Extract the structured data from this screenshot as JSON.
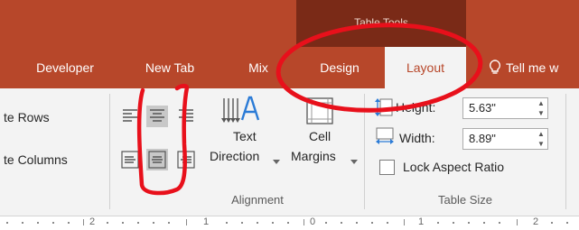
{
  "context": {
    "label": "Table Tools"
  },
  "tabs": [
    {
      "label": "Developer"
    },
    {
      "label": "New Tab"
    },
    {
      "label": "Mix"
    },
    {
      "label": "Design"
    },
    {
      "label": "Layout"
    },
    {
      "label": "Tell me w",
      "icon": "lightbulb-icon"
    }
  ],
  "rows_columns": {
    "rows_label": "te Rows",
    "columns_label": "te Columns"
  },
  "alignment": {
    "text_direction": {
      "line1": "Text",
      "line2": "Direction"
    },
    "cell_margins": {
      "line1": "Cell",
      "line2": "Margins"
    },
    "group_label": "Alignment"
  },
  "table_size": {
    "height": {
      "label": "Height:",
      "value": "5.63\""
    },
    "width": {
      "label": "Width:",
      "value": "8.89\""
    },
    "lock_aspect": {
      "label": "Lock Aspect Ratio",
      "checked": false
    },
    "group_label": "Table Size"
  },
  "ruler": {
    "numbers": [
      "2",
      "1",
      "0",
      "1",
      "2"
    ]
  },
  "colors": {
    "ribbon_accent": "#b7472a",
    "context_band": "#7a2a17",
    "annotation": "#e8101b"
  }
}
